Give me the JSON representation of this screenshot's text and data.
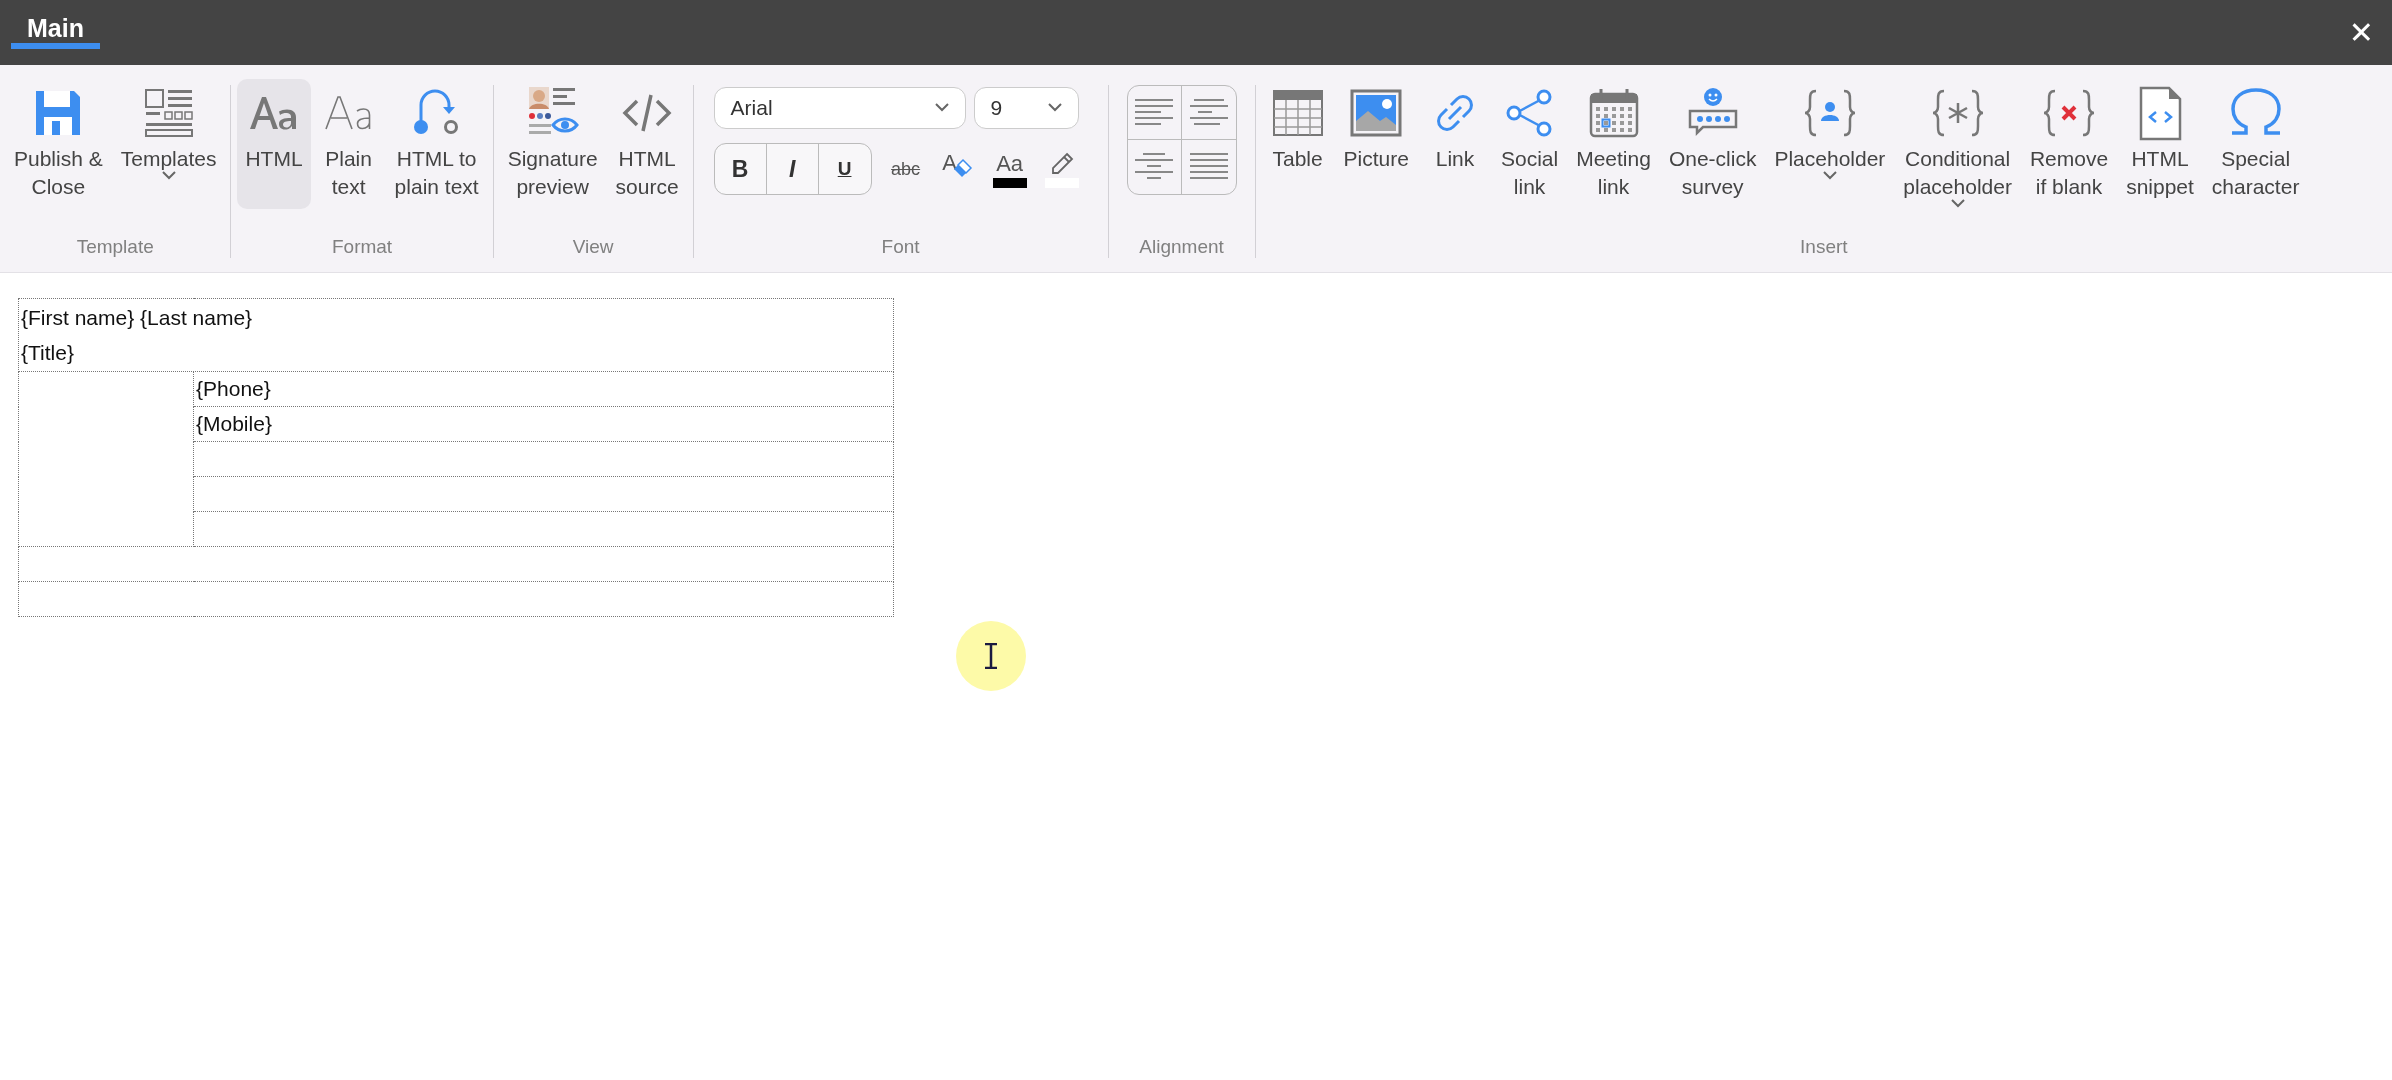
{
  "title_bar": {
    "tabs": [
      {
        "label": "Main",
        "selected": true
      }
    ],
    "close": "✕"
  },
  "ribbon": {
    "groups": [
      {
        "label": "Template",
        "items": [
          {
            "label": "Publish &\nClose",
            "selected": false,
            "dropdown": false
          },
          {
            "label": "Templates",
            "selected": false,
            "dropdown": true
          }
        ]
      },
      {
        "label": "Format",
        "items": [
          {
            "label": "HTML",
            "selected": true,
            "dropdown": false
          },
          {
            "label": "Plain\ntext",
            "selected": false,
            "dropdown": false
          },
          {
            "label": "HTML to\nplain text",
            "selected": false,
            "dropdown": false
          }
        ]
      },
      {
        "label": "View",
        "items": [
          {
            "label": "Signature\npreview",
            "selected": false,
            "dropdown": false
          },
          {
            "label": "HTML\nsource",
            "selected": false,
            "dropdown": false
          }
        ]
      },
      {
        "label": "Font",
        "kind": "font",
        "font": {
          "family": "Arial",
          "size": "9",
          "styles": [
            {
              "kind": "bold",
              "label": "B"
            },
            {
              "kind": "italic",
              "label": "I"
            },
            {
              "kind": "underline",
              "label": "U"
            }
          ],
          "strikethrough": "abc",
          "clear_format": "A",
          "font_color": {
            "label": "Aa",
            "color": "#000000"
          },
          "highlight": {
            "color": "#ffffff"
          }
        }
      },
      {
        "label": "Alignment",
        "kind": "alignment"
      },
      {
        "label": "Insert",
        "items": [
          {
            "label": "Table",
            "selected": false,
            "dropdown": false
          },
          {
            "label": "Picture",
            "selected": false,
            "dropdown": false
          },
          {
            "label": "Link",
            "selected": false,
            "dropdown": false
          },
          {
            "label": "Social\nlink",
            "selected": false,
            "dropdown": false
          },
          {
            "label": "Meeting\nlink",
            "selected": false,
            "dropdown": false
          },
          {
            "label": "One-click\nsurvey",
            "selected": false,
            "dropdown": false
          },
          {
            "label": "Placeholder",
            "selected": false,
            "dropdown": true
          },
          {
            "label": "Conditional\nplaceholder",
            "selected": false,
            "dropdown": true
          },
          {
            "label": "Remove\nif blank",
            "selected": false,
            "dropdown": false
          },
          {
            "label": "HTML\nsnippet",
            "selected": false,
            "dropdown": false
          },
          {
            "label": "Special\ncharacter",
            "selected": false,
            "dropdown": false
          }
        ]
      }
    ]
  },
  "editor": {
    "table": {
      "header_lines": [
        "{First name} {Last name}",
        "{Title}"
      ],
      "right_cells": [
        "{Phone}",
        "{Mobile}"
      ]
    }
  }
}
